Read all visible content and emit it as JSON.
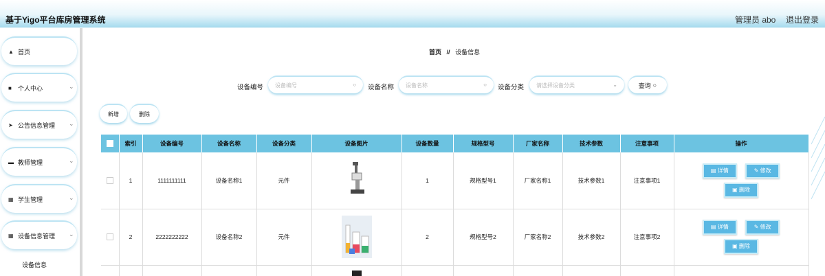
{
  "header": {
    "title": "基于Yigo平台库房管理系统",
    "user": "管理员 abo",
    "logout": "退出登录"
  },
  "sidebar": {
    "items": [
      {
        "icon": "home-icon",
        "label": "首页",
        "has_chevron": false
      },
      {
        "icon": "user-icon",
        "label": "个人中心",
        "has_chevron": true
      },
      {
        "icon": "send-icon",
        "label": "公告信息管理",
        "has_chevron": true
      },
      {
        "icon": "monitor-icon",
        "label": "教师管理",
        "has_chevron": true
      },
      {
        "icon": "grid-icon",
        "label": "学生管理",
        "has_chevron": true
      },
      {
        "icon": "grid-icon",
        "label": "设备信息管理",
        "has_chevron": true
      }
    ],
    "sub_item": "设备信息"
  },
  "breadcrumb": {
    "home": "首页",
    "sep": "//",
    "current": "设备信息"
  },
  "search": {
    "code_label": "设备编号",
    "code_placeholder": "设备编号",
    "name_label": "设备名称",
    "name_placeholder": "设备名称",
    "category_label": "设备分类",
    "category_placeholder": "请选择设备分类",
    "query_label": "查询"
  },
  "actions": {
    "add": "新增",
    "delete": "删除"
  },
  "table": {
    "columns": [
      "索引",
      "设备编号",
      "设备名称",
      "设备分类",
      "设备图片",
      "设备数量",
      "规格型号",
      "厂家名称",
      "技术参数",
      "注意事项",
      "操作"
    ],
    "rows": [
      {
        "index": "1",
        "code": "1111111111",
        "name": "设备名称1",
        "category": "元件",
        "image": "microscope",
        "qty": "1",
        "model": "规格型号1",
        "vendor": "厂家名称1",
        "params": "技术参数1",
        "notes": "注意事项1"
      },
      {
        "index": "2",
        "code": "2222222222",
        "name": "设备名称2",
        "category": "元件",
        "image": "lab-glassware",
        "qty": "2",
        "model": "规格型号2",
        "vendor": "厂家名称2",
        "params": "技术参数2",
        "notes": "注意事项2"
      }
    ],
    "op_detail": "详情",
    "op_edit": "修改",
    "op_delete": "删除"
  },
  "colors": {
    "accent": "#6cc3e1",
    "button": "#5ab8e3"
  }
}
